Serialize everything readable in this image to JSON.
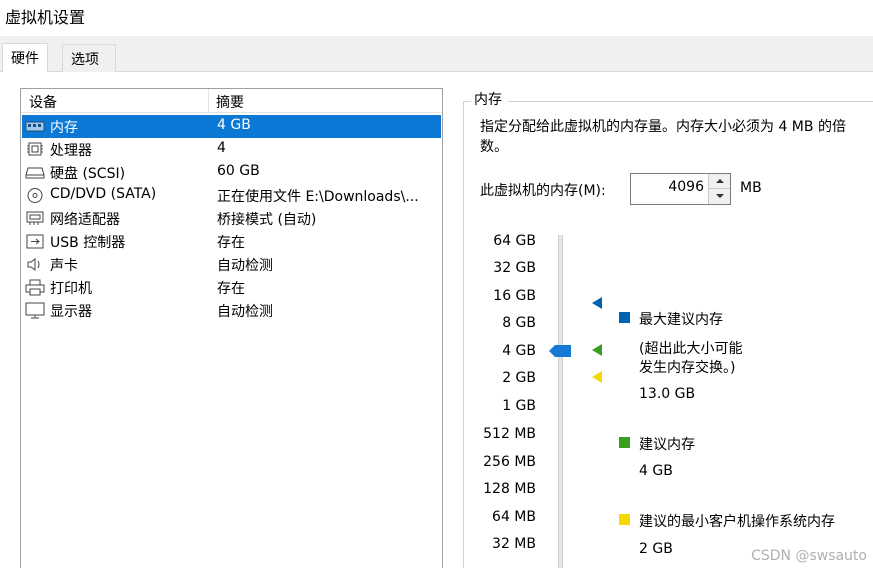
{
  "window": {
    "title": "虚拟机设置"
  },
  "tabs": [
    {
      "label": "硬件",
      "active": true
    },
    {
      "label": "选项",
      "active": false
    }
  ],
  "device_list": {
    "columns": [
      "设备",
      "摘要"
    ],
    "rows": [
      {
        "name": "内存",
        "summary": "4 GB",
        "icon": "memory-icon",
        "selected": true
      },
      {
        "name": "处理器",
        "summary": "4",
        "icon": "processor-icon",
        "selected": false
      },
      {
        "name": "硬盘 (SCSI)",
        "summary": "60 GB",
        "icon": "hard-disk-icon",
        "selected": false
      },
      {
        "name": "CD/DVD (SATA)",
        "summary": "正在使用文件 E:\\Downloads\\...",
        "icon": "cd-dvd-icon",
        "selected": false
      },
      {
        "name": "网络适配器",
        "summary": "桥接模式 (自动)",
        "icon": "network-adapter-icon",
        "selected": false
      },
      {
        "name": "USB 控制器",
        "summary": "存在",
        "icon": "usb-controller-icon",
        "selected": false
      },
      {
        "name": "声卡",
        "summary": "自动检测",
        "icon": "sound-card-icon",
        "selected": false
      },
      {
        "name": "打印机",
        "summary": "存在",
        "icon": "printer-icon",
        "selected": false
      },
      {
        "name": "显示器",
        "summary": "自动检测",
        "icon": "display-icon",
        "selected": false
      }
    ]
  },
  "memory": {
    "group_title": "内存",
    "description": "指定分配给此虚拟机的内存量。内存大小必须为 4 MB 的倍数。",
    "field_label": "此虚拟机的内存(M):",
    "value": "4096",
    "unit": "MB",
    "scale": [
      "64 GB",
      "32 GB",
      "16 GB",
      "8 GB",
      "4 GB",
      "2 GB",
      "1 GB",
      "512 MB",
      "256 MB",
      "128 MB",
      "64 MB",
      "32 MB"
    ],
    "slider_value": "4 GB",
    "legend": {
      "max_recommended": {
        "label": "最大建议内存",
        "note_line1": "(超出此大小可能",
        "note_line2": "发生内存交换。)",
        "value": "13.0 GB",
        "color": "#0063b1"
      },
      "recommended": {
        "label": "建议内存",
        "value": "4 GB",
        "color": "#3a9e1f"
      },
      "min_guest": {
        "label": "建议的最小客户机操作系统内存",
        "value": "2 GB",
        "color": "#f5d800"
      }
    }
  },
  "watermark": "CSDN @swsauto"
}
